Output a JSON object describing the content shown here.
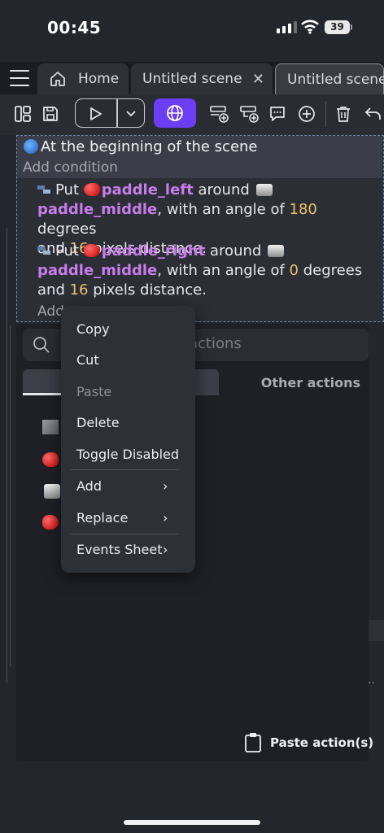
{
  "status": {
    "time": "00:45",
    "battery": "39"
  },
  "tabs": [
    {
      "label": "Home"
    },
    {
      "label": "Untitled scene"
    },
    {
      "label": "Untitled scene"
    }
  ],
  "event": {
    "condition": "At the beginning of the scene",
    "add_condition": "Add condition",
    "actions": [
      {
        "verb": "Put",
        "object": "paddle_left",
        "around": "around",
        "target": "paddle_middle",
        "pre_angle": ", with an angle of",
        "angle": "180",
        "degrees": "degrees",
        "and": "and",
        "distance": "16",
        "suffix": "pixels distance."
      },
      {
        "verb": "Put",
        "object": "paddle_right",
        "around": "around",
        "target": "paddle_middle",
        "pre_angle": ", with an angle of",
        "angle": "0",
        "degrees": "degrees",
        "and": "and",
        "distance": "16",
        "suffix": "pixels distance."
      }
    ],
    "add_action": "Add"
  },
  "chooser": {
    "search_placeholder": "actions",
    "tab_other": "Other actions",
    "paste_label": "Paste action(s)"
  },
  "context_menu": {
    "items": [
      {
        "label": "Copy"
      },
      {
        "label": "Cut"
      },
      {
        "label": "Paste"
      },
      {
        "label": "Delete"
      },
      {
        "label": "Toggle Disabled"
      },
      {
        "label": "Add"
      },
      {
        "label": "Replace"
      },
      {
        "label": "Events Sheet"
      }
    ]
  },
  "colors": {
    "accent": "#6b3df5",
    "object": "#c77dea",
    "number": "#e8c26a"
  }
}
